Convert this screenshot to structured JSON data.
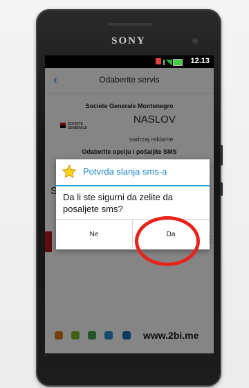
{
  "device": {
    "brand": "SONY"
  },
  "status_bar": {
    "time": "12.13"
  },
  "app": {
    "title": "Odaberite servis",
    "bank_name": "Societe Generale Montenegro",
    "logo_text_1": "SOCIETE",
    "logo_text_2": "GENERALE",
    "headline": "NASLOV",
    "subheadline": "sadrzaj reklame",
    "instruction": "Odaberite opciju i pošaljite SMS",
    "partial_left": "S",
    "partial_right": "E"
  },
  "dialog": {
    "title": "Potvrda slanja sms-a",
    "message": "Da li ste sigurni da zelite da posaljete sms?",
    "buttons": {
      "no": "Ne",
      "yes": "Da"
    }
  },
  "footer": {
    "site": "www.2bi.me"
  },
  "colors": {
    "accent": "#1ea1d6",
    "title_blue": "#1a86c8",
    "highlight": "#e8231c",
    "back_arrow": "#2a7cd6"
  }
}
